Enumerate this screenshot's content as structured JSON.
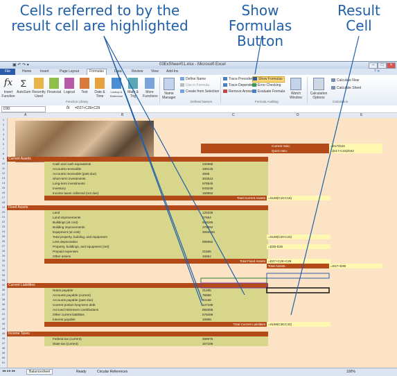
{
  "callouts": {
    "cells_referred": "Cells referred to by the result cell are highlighted",
    "show_formulas": "Show Formulas Button",
    "result_cell": "Result Cell"
  },
  "window": {
    "title": "03ExShee#01.xlsx - Microsoft Excel"
  },
  "ribbon": {
    "tabs": [
      "File",
      "Home",
      "Insert",
      "Page Layout",
      "Formulas",
      "Data",
      "Review",
      "View",
      "Add-Ins"
    ],
    "active_tab": "Formulas",
    "library_buttons": [
      "Insert Function",
      "AutoSum",
      "Recently Used",
      "Financial",
      "Logical",
      "Text",
      "Date & Time",
      "Lookup & Reference",
      "Math & Trig",
      "More Functions"
    ],
    "name_manager": "Name Manager",
    "defined_names": [
      "Define Name",
      "Use in Formula",
      "Create from Selection"
    ],
    "auditing": [
      "Trace Precedents",
      "Trace Dependents",
      "Remove Arrows",
      "Show Formulas",
      "Error Checking",
      "Evaluate Formula"
    ],
    "watch_window": "Watch Window",
    "calc_options": "Calculation Options",
    "calc": [
      "Calculate Now",
      "Calculate Sheet"
    ],
    "groups": [
      "Function Library",
      "Defined Names",
      "Formula Auditing",
      "Calculation"
    ]
  },
  "formula_bar": {
    "name_box": "D30",
    "fx": "fx",
    "formula": "=D27+C28+C29"
  },
  "columns": [
    "A",
    "B",
    "C",
    "D",
    "E"
  ],
  "ratios": {
    "current_label": "Current ratio:",
    "current_formula": "=D17/D43",
    "quick_label": "Quick ratio:",
    "quick_formula": "=(D17-C15)/D43"
  },
  "current_assets": {
    "header": "Current Assets",
    "items": [
      {
        "label": "Cash and cash equivalents",
        "value": "232965"
      },
      {
        "label": "Accounts receivable",
        "value": "189125"
      },
      {
        "label": "Accounts receivable (past due)",
        "value": "4568"
      },
      {
        "label": "Short-term investments",
        "value": "402613"
      },
      {
        "label": "Long-term investments",
        "value": "976545"
      },
      {
        "label": "Inventory",
        "value": "543245"
      },
      {
        "label": "Income taxes collected (not due)",
        "value": "158952"
      }
    ],
    "total_label": "Total Current Assets",
    "total_formula": "=SUM(C10:C16)"
  },
  "fixed_assets": {
    "header": "Fixed Assets",
    "items": [
      {
        "label": "Land",
        "value": "125335"
      },
      {
        "label": "Land improvements",
        "value": "27654"
      },
      {
        "label": "Buildings (at cost)",
        "value": "658165"
      },
      {
        "label": "Building improvements",
        "value": "375862"
      },
      {
        "label": "Equipment (at cost)",
        "value": "3050656"
      },
      {
        "label": "Total property, building, and equipment",
        "value": "=SUM(C20:C24)"
      },
      {
        "label": "Less depreciation",
        "value": "896552"
      },
      {
        "label": "Property, buildings, and equipment (net)",
        "value": "=D25-D26"
      },
      {
        "label": "Prepaid expenses",
        "value": "21565"
      },
      {
        "label": "Other assets",
        "value": "46652"
      }
    ],
    "total_label": "Total Fixed Assets",
    "total_formula": "=D27+C28+C29",
    "total_assets_label": "Total Assets",
    "total_assets_formula": "=D17+D30"
  },
  "current_liabilities": {
    "header": "Current Liabilities",
    "items": [
      {
        "label": "Notes payable",
        "value": "21465"
      },
      {
        "label": "Accounts payable (current)",
        "value": "78958"
      },
      {
        "label": "Accounts payable (past due)",
        "value": "34158"
      },
      {
        "label": "Current portion long-term debt",
        "value": "137185"
      },
      {
        "label": "Accrued retirement contributions",
        "value": "892065"
      },
      {
        "label": "Other current liabilities",
        "value": "578495"
      },
      {
        "label": "Interest payable",
        "value": "18958"
      }
    ],
    "total_label": "Total Current Liabilities",
    "total_formula": "=SUM(C36:C42)"
  },
  "income_taxes": {
    "header": "Income Taxes",
    "items": [
      {
        "label": "Federal tax (current)",
        "value": "288975"
      },
      {
        "label": "State tax (current)",
        "value": "157165"
      }
    ]
  },
  "status": {
    "sheet_tab": "Balancesheet",
    "ready": "Ready",
    "circular": "Circular References",
    "zoom": "100%"
  },
  "colors": {
    "callout": "#1f5fa8",
    "header_band": "#b44a17",
    "data_band": "#d7d68a",
    "sheet_bg": "#fde3c6",
    "highlight": "#ffd97a"
  }
}
